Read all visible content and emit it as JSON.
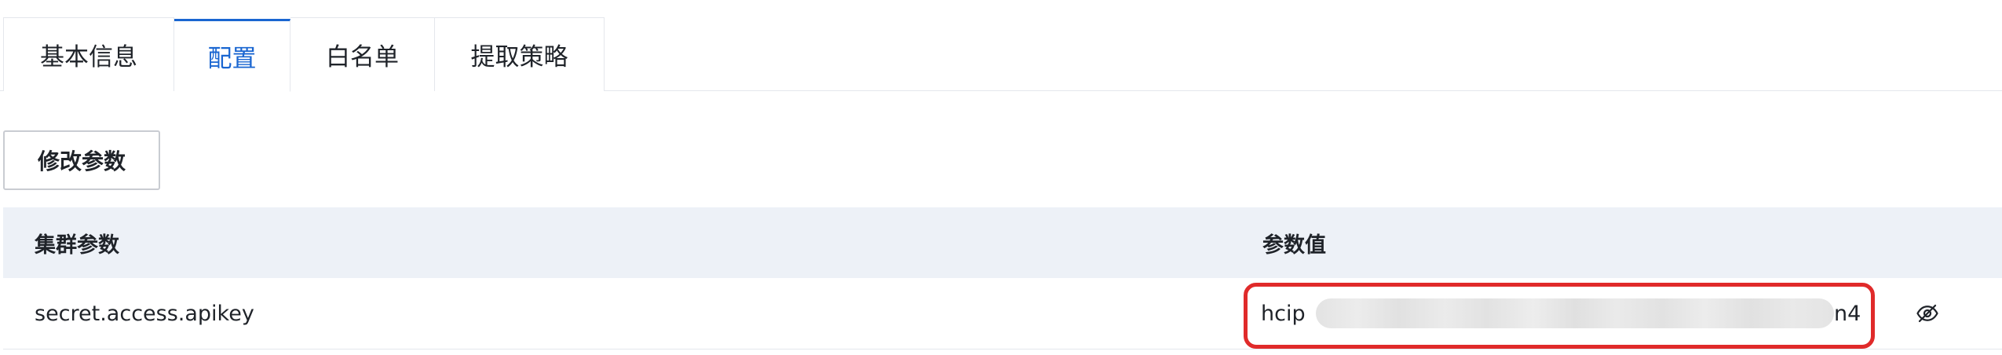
{
  "tabs": [
    {
      "label": "基本信息",
      "active": false
    },
    {
      "label": "配置",
      "active": true
    },
    {
      "label": "白名单",
      "active": false
    },
    {
      "label": "提取策略",
      "active": false
    }
  ],
  "toolbar": {
    "modify_label": "修改参数"
  },
  "table": {
    "headers": {
      "param": "集群参数",
      "value": "参数值"
    },
    "rows": [
      {
        "param": "secret.access.apikey",
        "value_prefix": "hcip",
        "value_suffix": "n4",
        "value_masked": true,
        "visibility_icon": "eye-hidden-icon"
      }
    ]
  },
  "colors": {
    "accent": "#1a66d1",
    "highlight": "#e02a2a",
    "header_bg": "#edf1f7"
  }
}
